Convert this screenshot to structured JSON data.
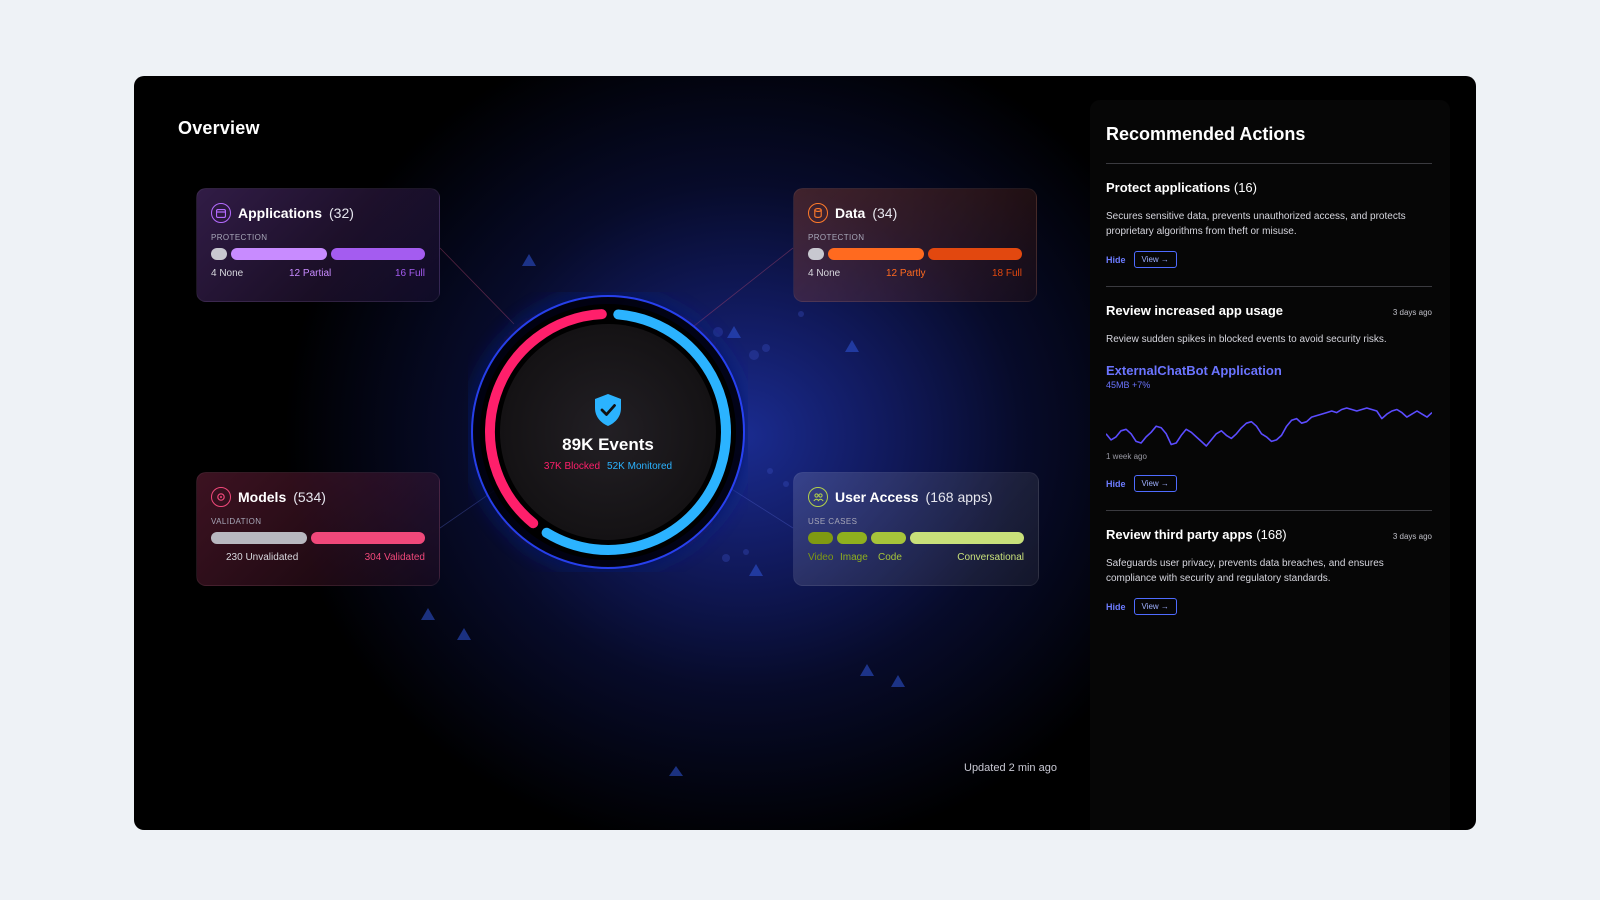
{
  "overview": {
    "title": "Overview"
  },
  "center": {
    "events": "89K Events",
    "blocked": "37K Blocked",
    "monitored": "52K Monitored",
    "blocked_value": 37,
    "monitored_value": 52,
    "colors": {
      "blocked": "#ff1f6b",
      "monitored": "#2bb3ff"
    }
  },
  "applications": {
    "title": "Applications",
    "count": "(32)",
    "sub": "PROTECTION",
    "bars": [
      {
        "label": "4 None",
        "value": 4,
        "color": "#c8c8d0"
      },
      {
        "label": "12 Partial",
        "value": 12,
        "color": "#c88bff"
      },
      {
        "label": "16 Full",
        "value": 16,
        "color": "#a45cf0"
      }
    ]
  },
  "data": {
    "title": "Data",
    "count": "(34)",
    "sub": "PROTECTION",
    "bars": [
      {
        "label": "4 None",
        "value": 4,
        "color": "#c8c8d0"
      },
      {
        "label": "12 Partly",
        "value": 12,
        "color": "#ff6a1f"
      },
      {
        "label": "18 Full",
        "value": 18,
        "color": "#e2480f"
      }
    ]
  },
  "models": {
    "title": "Models",
    "count": "(534)",
    "sub": "VALIDATION",
    "bars": [
      {
        "label": "230 Unvalidated",
        "value": 230,
        "color": "#b8b8c0"
      },
      {
        "label": "304 Validated",
        "value": 304,
        "color": "#f0487a"
      }
    ]
  },
  "user_access": {
    "title": "User Access",
    "count": "(168 apps)",
    "sub": "USE CASES",
    "bars": [
      {
        "label": "Video",
        "color": "#7f9a12"
      },
      {
        "label": "Image",
        "color": "#8fb01e"
      },
      {
        "label": "Code",
        "color": "#a6c43a"
      },
      {
        "label": "Conversational",
        "color": "#c8e07a"
      }
    ]
  },
  "updated": "Updated 2 min ago",
  "panel": {
    "title": "Recommended Actions",
    "sections": [
      {
        "title": "Protect applications",
        "count": "(16)",
        "time": "",
        "desc": "Secures sensitive data, prevents unauthorized access, and protects proprietary algorithms from theft or misuse.",
        "hide": "Hide",
        "view": "View →"
      },
      {
        "title": "Review increased app usage",
        "count": "",
        "time": "3 days ago",
        "desc": "Review sudden spikes in blocked events to avoid security risks.",
        "app_name": "ExternalChatBot Application",
        "app_meta": "45MB +7%",
        "week": "1 week ago",
        "hide": "Hide",
        "view": "View →"
      },
      {
        "title": "Review third party apps",
        "count": "(168)",
        "time": "3 days ago",
        "desc": "Safeguards user privacy, prevents data breaches, and ensures compliance with security and regulatory standards.",
        "hide": "Hide",
        "view": "View →"
      }
    ]
  },
  "chart_data": {
    "type": "line",
    "series": [
      {
        "values": [
          30,
          22,
          26,
          34,
          36,
          30,
          20,
          18,
          26,
          32,
          40,
          38,
          30,
          16,
          18,
          28,
          36,
          32,
          26,
          20,
          14,
          22,
          30,
          34,
          28,
          24,
          30,
          38,
          44,
          46,
          40,
          30,
          26,
          20,
          22,
          28,
          40,
          48,
          50,
          44,
          46,
          52,
          54,
          56,
          58,
          60,
          58,
          62,
          64,
          62,
          60,
          62,
          64,
          62,
          60,
          50,
          56,
          60,
          62,
          58,
          52,
          56,
          60,
          56,
          52,
          58
        ]
      }
    ],
    "xlabel": "",
    "ylabel": "",
    "grid": false
  }
}
